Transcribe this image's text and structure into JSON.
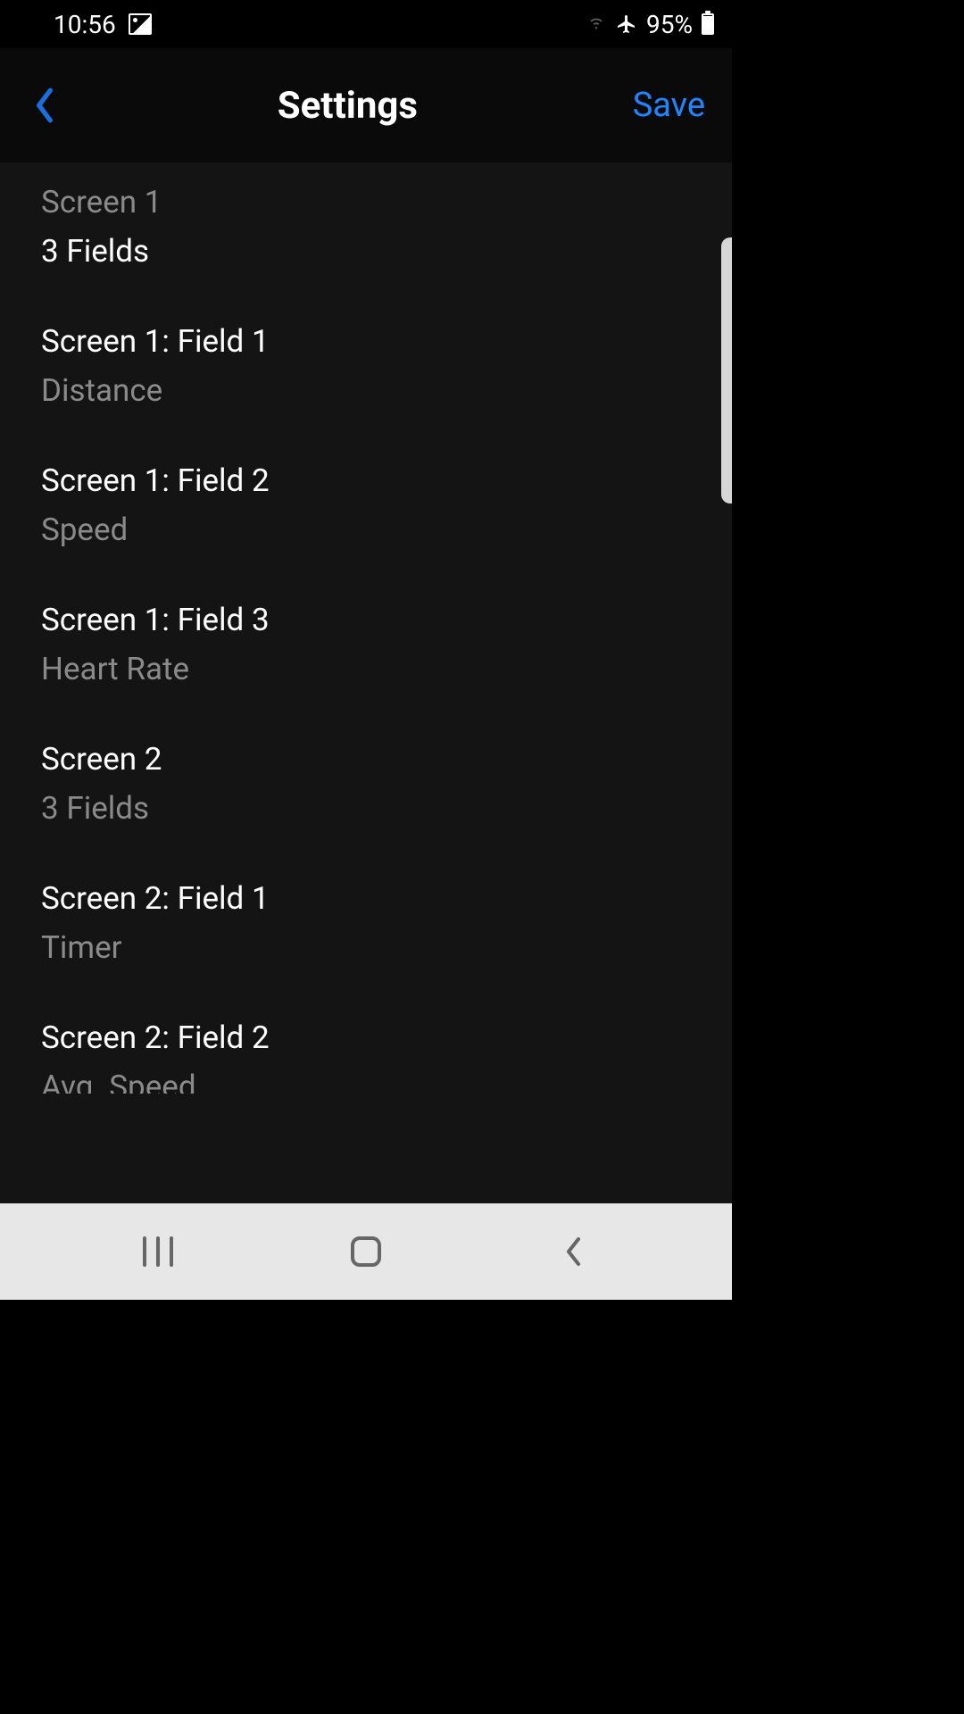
{
  "status": {
    "time": "10:56",
    "battery": "95%"
  },
  "header": {
    "title": "Settings",
    "save": "Save"
  },
  "rows": [
    {
      "title": "Screen 1",
      "sub": "3 Fields"
    },
    {
      "title": "Screen 1: Field 1",
      "sub": "Distance"
    },
    {
      "title": "Screen 1: Field 2",
      "sub": "Speed"
    },
    {
      "title": "Screen 1: Field 3",
      "sub": "Heart Rate"
    },
    {
      "title": "Screen 2",
      "sub": "3 Fields"
    },
    {
      "title": "Screen 2: Field 1",
      "sub": "Timer"
    },
    {
      "title": "Screen 2: Field 2",
      "sub": "Avg. Speed"
    }
  ]
}
